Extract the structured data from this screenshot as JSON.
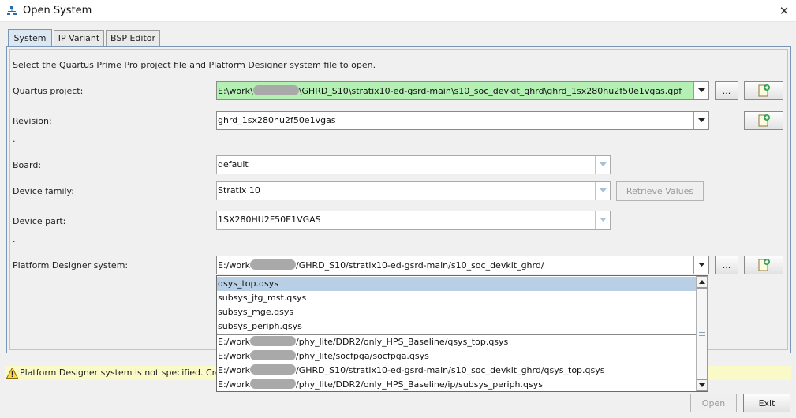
{
  "window": {
    "title": "Open System",
    "close_glyph": "✕"
  },
  "tabs": [
    {
      "label": "System",
      "active": true
    },
    {
      "label": "IP Variant",
      "active": false
    },
    {
      "label": "BSP Editor",
      "active": false
    }
  ],
  "instructions": "Select the Quartus Prime Pro project file and Platform Designer system file to open.",
  "fields": {
    "quartus_project": {
      "label": "Quartus project:",
      "value_prefix": "E:\\work\\",
      "value_suffix": "\\GHRD_S10\\stratix10-ed-gsrd-main\\s10_soc_devkit_ghrd\\ghrd_1sx280hu2f50e1vgas.qpf",
      "bg": "#b4f0b4"
    },
    "revision": {
      "label": "Revision:",
      "value": "ghrd_1sx280hu2f50e1vgas"
    },
    "revision_dot": ".",
    "board": {
      "label": "Board:",
      "value": "default"
    },
    "device_family": {
      "label": "Device family:",
      "value": "Stratix 10"
    },
    "device_part": {
      "label": "Device part:",
      "value": "1SX280HU2F50E1VGAS"
    },
    "device_dot": ".",
    "platform_designer": {
      "label": "Platform Designer system:",
      "value_prefix": "E:/work",
      "value_suffix": "/GHRD_S10/stratix10-ed-gsrd-main/s10_soc_devkit_ghrd/"
    }
  },
  "buttons": {
    "browse": "...",
    "retrieve_values": "Retrieve Values",
    "open": "Open",
    "exit": "Exit"
  },
  "dropdown": {
    "items_local": [
      "qsys_top.qsys",
      "subsys_jtg_mst.qsys",
      "subsys_mge.qsys",
      "subsys_periph.qsys"
    ],
    "items_recent": [
      {
        "prefix": "E:/work",
        "suffix": "/phy_lite/DDR2/only_HPS_Baseline/qsys_top.qsys"
      },
      {
        "prefix": "E:/work",
        "suffix": "/phy_lite/socfpga/socfpga.qsys"
      },
      {
        "prefix": "E:/work",
        "suffix": "/GHRD_S10/stratix10-ed-gsrd-main/s10_soc_devkit_ghrd/qsys_top.qsys"
      },
      {
        "prefix": "E:/work",
        "suffix": "/phy_lite/DDR2/only_HPS_Baseline/ip/subsys_periph.qsys"
      }
    ],
    "selected_index": 0
  },
  "warning": {
    "text": "Platform Designer system is not specified. Create or",
    "bg": "#fafac8"
  },
  "colors": {
    "accent": "#7a96b4",
    "selection": "#b8cfe5",
    "valid_field": "#b4f0b4"
  },
  "icons": [
    "app-icon",
    "close-icon",
    "new-file-icon",
    "chevron-down-icon",
    "warning-icon",
    "scroll-up-icon",
    "scroll-down-icon"
  ]
}
